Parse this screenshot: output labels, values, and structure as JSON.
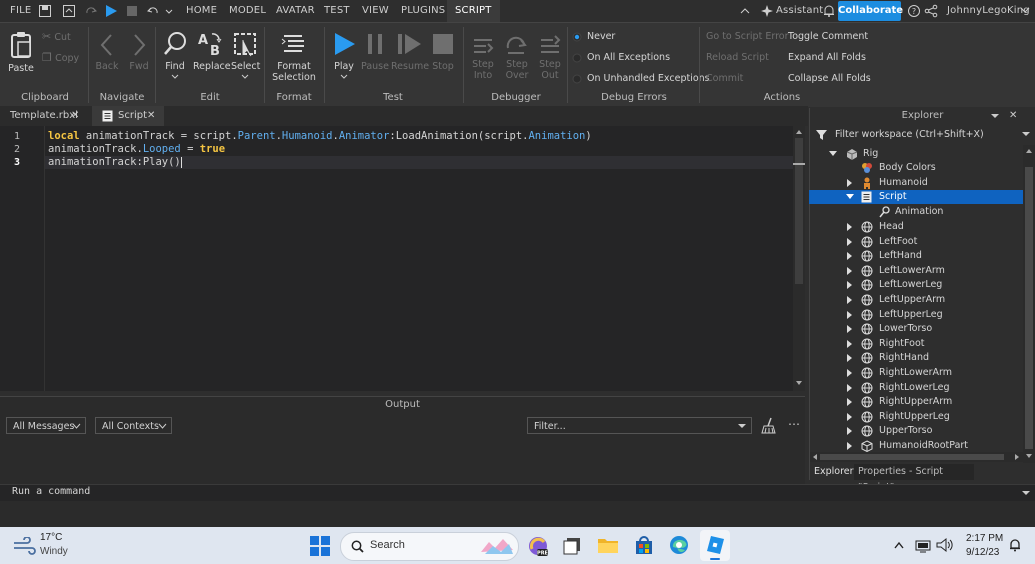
{
  "menu": {
    "file": "FILE",
    "tabs": [
      "HOME",
      "MODEL",
      "AVATAR",
      "TEST",
      "VIEW",
      "PLUGINS",
      "SCRIPT"
    ],
    "active_tab": "SCRIPT",
    "assistant": "Assistant",
    "collaborate": "Collaborate",
    "user": "JohnnyLegoKing"
  },
  "ribbon": {
    "clipboard": {
      "paste": "Paste",
      "cut": "Cut",
      "copy": "Copy",
      "group": "Clipboard"
    },
    "navigate": {
      "back": "Back",
      "fwd": "Fwd",
      "group": "Navigate"
    },
    "edit": {
      "find": "Find",
      "replace": "Replace",
      "select": "Select",
      "group": "Edit"
    },
    "format": {
      "label1": "Format",
      "label2": "Selection",
      "group": "Format"
    },
    "test": {
      "play": "Play",
      "pause": "Pause",
      "resume": "Resume",
      "stop": "Stop",
      "group": "Test"
    },
    "debugger": {
      "step_into_1": "Step",
      "step_into_2": "Into",
      "step_over_1": "Step",
      "step_over_2": "Over",
      "step_out_1": "Step",
      "step_out_2": "Out",
      "group": "Debugger"
    },
    "debug_errors": {
      "never": "Never",
      "all": "On All Exceptions",
      "unhandled": "On Unhandled Exceptions",
      "group": "Debug Errors"
    },
    "actions": {
      "goto": "Go to Script Error",
      "reload": "Reload Script",
      "commit": "Commit",
      "toggle": "Toggle Comment",
      "expand": "Expand All Folds",
      "collapse": "Collapse All Folds",
      "group": "Actions"
    }
  },
  "doc_tabs": [
    {
      "label": "Template.rbxl"
    },
    {
      "label": "Script"
    }
  ],
  "editor": {
    "lines": [
      "1",
      "2",
      "3"
    ],
    "line1": {
      "kw": "local",
      "a": " animationTrack = script.",
      "b": "Parent",
      "c": ".",
      "d": "Humanoid",
      "e": ".",
      "f": "Animator",
      "g": ":LoadAnimation(script.",
      "h": "Animation",
      "i": ")"
    },
    "line2": {
      "a": "animationTrack.",
      "b": "Looped",
      "c": " = ",
      "kw": "true"
    },
    "line3": {
      "a": "animationTrack:Play()"
    }
  },
  "output": {
    "title": "Output",
    "all_messages": "All Messages",
    "all_contexts": "All Contexts",
    "filter_placeholder": "Filter..."
  },
  "command_bar": {
    "placeholder": "Run a command"
  },
  "explorer": {
    "title": "Explorer",
    "filter_placeholder": "Filter workspace (Ctrl+Shift+X)",
    "items": [
      {
        "label": "Rig"
      },
      {
        "label": "Body Colors"
      },
      {
        "label": "Humanoid"
      },
      {
        "label": "Script"
      },
      {
        "label": "Animation"
      },
      {
        "label": "Head"
      },
      {
        "label": "LeftFoot"
      },
      {
        "label": "LeftHand"
      },
      {
        "label": "LeftLowerArm"
      },
      {
        "label": "LeftLowerLeg"
      },
      {
        "label": "LeftUpperArm"
      },
      {
        "label": "LeftUpperLeg"
      },
      {
        "label": "LowerTorso"
      },
      {
        "label": "RightFoot"
      },
      {
        "label": "RightHand"
      },
      {
        "label": "RightLowerArm"
      },
      {
        "label": "RightLowerLeg"
      },
      {
        "label": "RightUpperArm"
      },
      {
        "label": "RightUpperLeg"
      },
      {
        "label": "UpperTorso"
      },
      {
        "label": "HumanoidRootPart"
      }
    ],
    "bottom_tabs": [
      "Explorer",
      "Properties - Script \"Script\""
    ]
  },
  "taskbar": {
    "weather_temp": "17°C",
    "weather_desc": "Windy",
    "search": "Search",
    "time": "2:17 PM",
    "date": "9/12/23"
  },
  "colors": {
    "accent": "#1c8de0",
    "selection": "#0f63c0",
    "keyword": "#f5c542",
    "property": "#61afef"
  }
}
